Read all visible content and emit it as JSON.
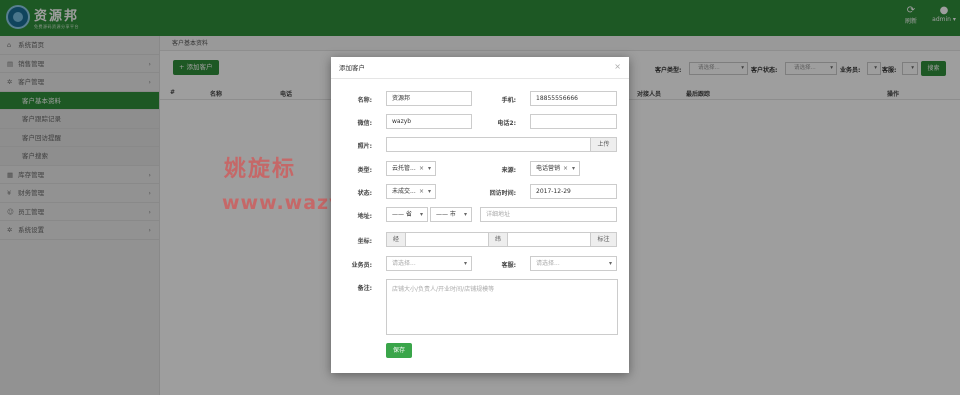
{
  "header": {
    "brand": "资源邦",
    "brand_sub": "免费源码资源分享平台",
    "refresh_label": "刷新",
    "user_label": "admin ▾"
  },
  "sidebar": {
    "items": [
      {
        "icon": "home-icon",
        "label": "系统首页"
      },
      {
        "icon": "cart-icon",
        "label": "销售管理"
      },
      {
        "icon": "gear-icon",
        "label": "客户管理"
      }
    ],
    "sub_items": [
      {
        "label": "客户基本资料",
        "active": true
      },
      {
        "label": "客户跟踪记录",
        "active": false
      },
      {
        "label": "客户回访提醒",
        "active": false
      },
      {
        "label": "客户搜索",
        "active": false
      }
    ],
    "more_items": [
      {
        "icon": "archive-icon",
        "label": "库存管理"
      },
      {
        "icon": "money-icon",
        "label": "财务管理"
      },
      {
        "icon": "user-icon",
        "label": "员工管理"
      },
      {
        "icon": "gear-icon",
        "label": "系统设置"
      }
    ]
  },
  "main": {
    "breadcrumb": "客户基本资料",
    "add_button": "添加客户",
    "filters": {
      "customer_type_label": "客户类型:",
      "customer_type_value": "请选择...",
      "customer_status_label": "客户状态:",
      "customer_status_value": "请选择...",
      "salesperson_label": "业务员:",
      "support_label": "客服:",
      "search_button": "搜索"
    },
    "table_headers": [
      "#",
      "名称",
      "电话",
      "对接人员",
      "最后跟踪",
      "操作"
    ]
  },
  "modal": {
    "title": "添加客户",
    "close": "×",
    "fields": {
      "name_label": "名称:",
      "name_value": "资源邦",
      "mobile_label": "手机:",
      "mobile_value": "18855556666",
      "wechat_label": "微信:",
      "wechat_value": "wazyb",
      "phone2_label": "电话2:",
      "phone2_value": "",
      "photo_label": "照片:",
      "upload_button": "上传",
      "type_label": "类型:",
      "type_value": "云托管...",
      "source_label": "来源:",
      "source_value": "电话营销",
      "status_label": "状态:",
      "status_value": "未成交...",
      "visit_time_label": "回访时间:",
      "visit_time_value": "2017-12-29",
      "address_label": "地址:",
      "province_value": "—— 省",
      "city_value": "—— 市",
      "detail_address_placeholder": "详细地址",
      "coord_label": "坐标:",
      "lng_addon": "经",
      "lat_addon": "纬",
      "mark_button": "标注",
      "salesperson_label": "业务员:",
      "salesperson_placeholder": "请选择...",
      "support_label": "客服:",
      "support_placeholder": "请选择...",
      "remark_label": "备注:",
      "remark_placeholder": "店铺大小/负责人/开业时间/店铺规模等",
      "save_button": "保存"
    }
  },
  "watermark": {
    "text_cn": "姚旋标",
    "text_url": "www.wazyb.com"
  }
}
